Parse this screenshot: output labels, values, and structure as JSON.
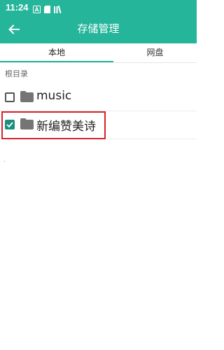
{
  "status_bar": {
    "time": "11:24"
  },
  "toolbar": {
    "title": "存储管理"
  },
  "tabs": [
    {
      "label": "本地"
    },
    {
      "label": "网盘"
    }
  ],
  "breadcrumb": "根目录",
  "folders": [
    {
      "name": "music",
      "checked": false
    },
    {
      "name": "新编赞美诗",
      "checked": true
    }
  ],
  "colors": {
    "accent": "#25b59a",
    "checkbox_checked": "#1a8f80",
    "highlight": "#d8232a"
  }
}
